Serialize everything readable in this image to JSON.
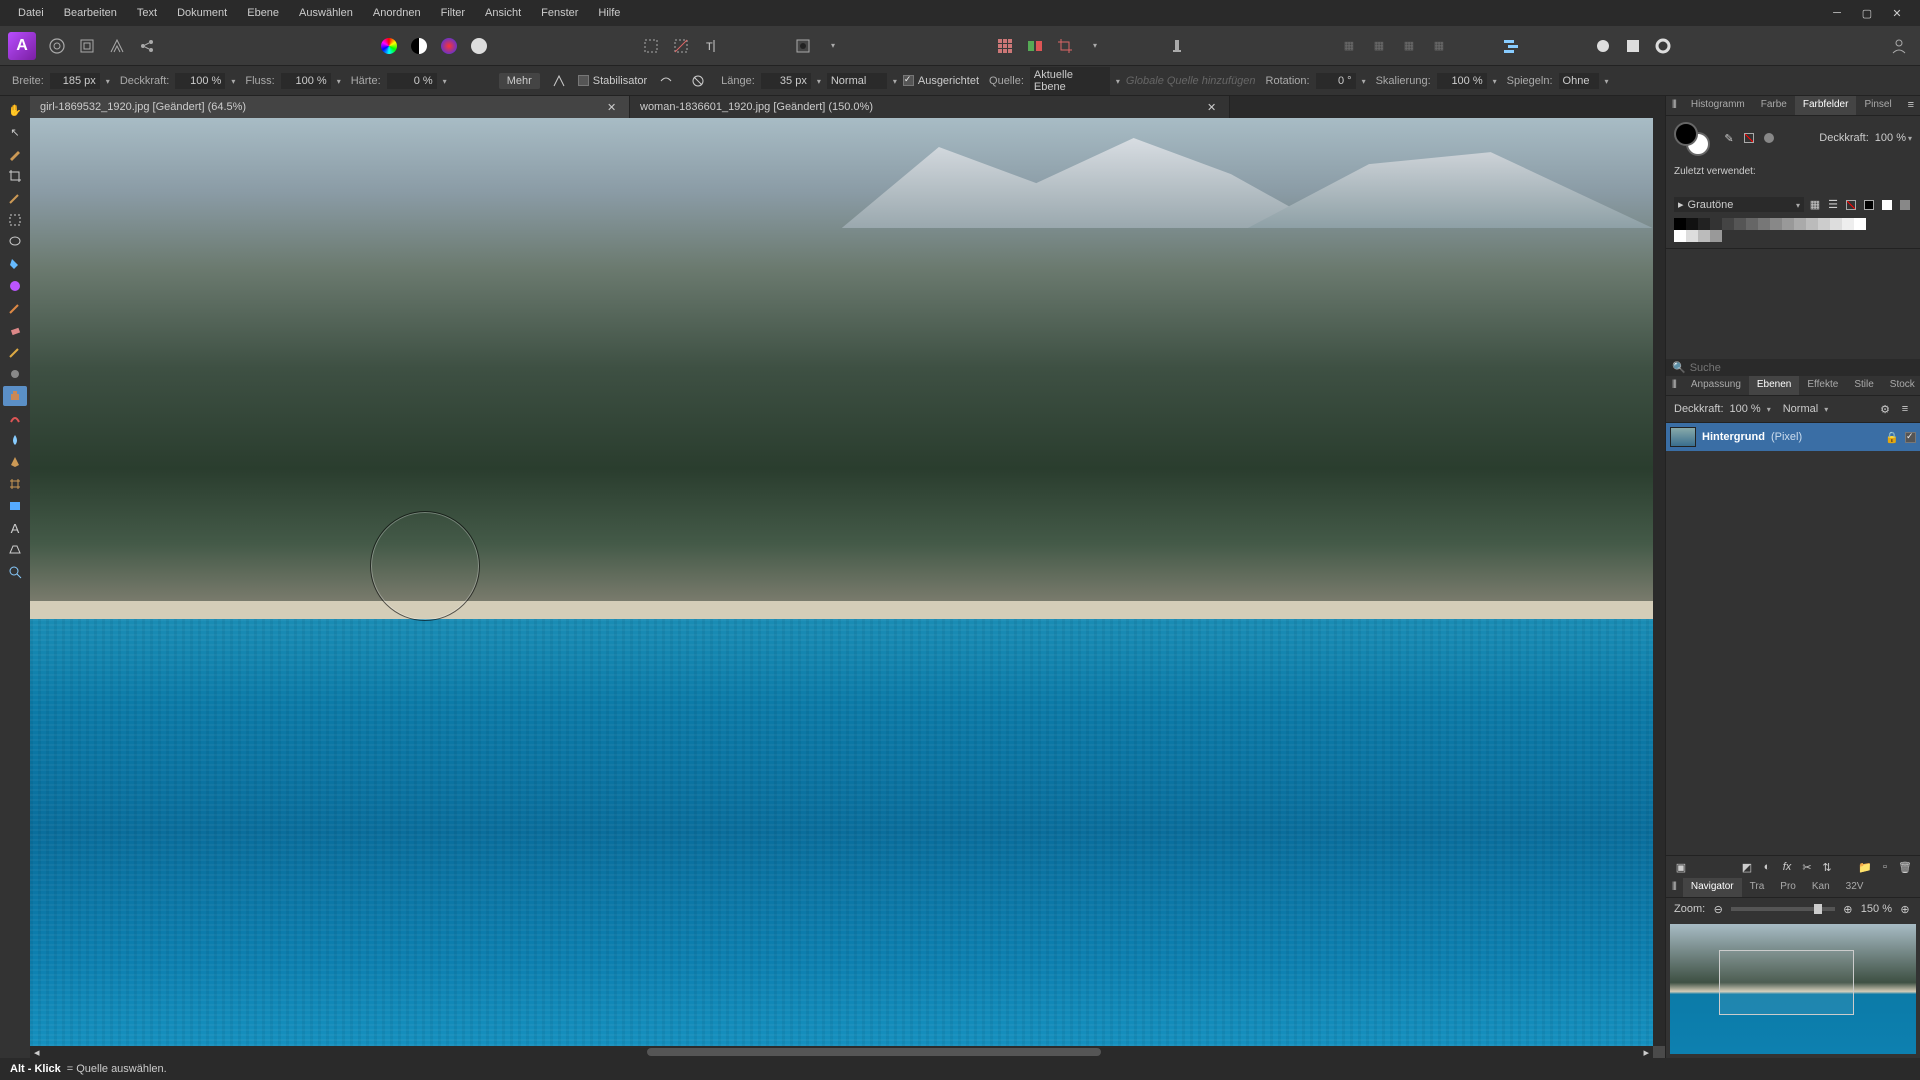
{
  "menu": {
    "items": [
      "Datei",
      "Bearbeiten",
      "Text",
      "Dokument",
      "Ebene",
      "Auswählen",
      "Anordnen",
      "Filter",
      "Ansicht",
      "Fenster",
      "Hilfe"
    ]
  },
  "options": {
    "breite_label": "Breite:",
    "breite": "185 px",
    "deckkraft_label": "Deckkraft:",
    "deckkraft": "100 %",
    "fluss_label": "Fluss:",
    "fluss": "100 %",
    "haerte_label": "Härte:",
    "haerte": "0 %",
    "mehr": "Mehr",
    "stabilisator": "Stabilisator",
    "laenge_label": "Länge:",
    "laenge": "35 px",
    "blend": "Normal",
    "ausgerichtet": "Ausgerichtet",
    "quelle_label": "Quelle:",
    "quelle": "Aktuelle Ebene",
    "globale_quelle": "Globale Quelle hinzufügen",
    "rotation_label": "Rotation:",
    "rotation": "0 °",
    "skalierung_label": "Skalierung:",
    "skalierung": "100 %",
    "spiegeln_label": "Spiegeln:",
    "spiegeln": "Ohne"
  },
  "tabs": [
    {
      "title": "girl-1869532_1920.jpg [Geändert] (64.5%)",
      "active": true
    },
    {
      "title": "woman-1836601_1920.jpg [Geändert] (150.0%)",
      "active": false
    }
  ],
  "right": {
    "top_tabs": [
      "Histogramm",
      "Farbe",
      "Farbfelder",
      "Pinsel"
    ],
    "top_active": "Farbfelder",
    "deckkraft_label": "Deckkraft:",
    "deckkraft": "100 %",
    "recent_label": "Zuletzt verwendet:",
    "swatch_preset": "Grautöne",
    "search_placeholder": "Suche",
    "mid_tabs": [
      "Anpassung",
      "Ebenen",
      "Effekte",
      "Stile",
      "Stock"
    ],
    "mid_active": "Ebenen",
    "layer_deckkraft_label": "Deckkraft:",
    "layer_deckkraft": "100 %",
    "layer_blend": "Normal",
    "layer_name": "Hintergrund",
    "layer_type": "(Pixel)",
    "nav_tabs": [
      "Navigator",
      "Tra",
      "Pro",
      "Kan",
      "32V"
    ],
    "nav_active": "Navigator",
    "zoom_label": "Zoom:",
    "zoom": "150 %"
  },
  "status": {
    "key": "Alt - Klick",
    "desc": " = Quelle auswählen."
  }
}
